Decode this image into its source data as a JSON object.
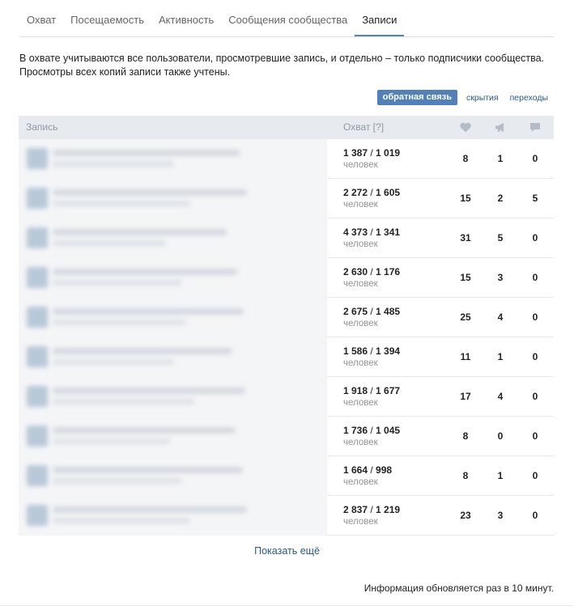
{
  "tabs": [
    {
      "label": "Охват"
    },
    {
      "label": "Посещаемость"
    },
    {
      "label": "Активность"
    },
    {
      "label": "Сообщения сообщества"
    },
    {
      "label": "Записи",
      "active": true
    }
  ],
  "description": {
    "line1": "В охвате учитываются все пользователи, просмотревшие запись, и отдельно – только подписчики сообщества.",
    "line2": "Просмотры всех копий записи также учтены."
  },
  "filters": {
    "feedback": "обратная связь",
    "hides": "скрытия",
    "clicks": "переходы"
  },
  "table": {
    "headers": {
      "post": "Запись",
      "reach": "Охват [?]",
      "likes_icon": "heart-icon",
      "shares_icon": "megaphone-icon",
      "comments_icon": "comment-icon"
    },
    "unit": "человек",
    "rows": [
      {
        "total": "1 387",
        "subscribers": "1 019",
        "likes": "8",
        "shares": "1",
        "comments": "0"
      },
      {
        "total": "2 272",
        "subscribers": "1 605",
        "likes": "15",
        "shares": "2",
        "comments": "5"
      },
      {
        "total": "4 373",
        "subscribers": "1 341",
        "likes": "31",
        "shares": "5",
        "comments": "0"
      },
      {
        "total": "2 630",
        "subscribers": "1 176",
        "likes": "15",
        "shares": "3",
        "comments": "0"
      },
      {
        "total": "2 675",
        "subscribers": "1 485",
        "likes": "25",
        "shares": "4",
        "comments": "0"
      },
      {
        "total": "1 586",
        "subscribers": "1 394",
        "likes": "11",
        "shares": "1",
        "comments": "0"
      },
      {
        "total": "1 918",
        "subscribers": "1 677",
        "likes": "17",
        "shares": "4",
        "comments": "0"
      },
      {
        "total": "1 736",
        "subscribers": "1 045",
        "likes": "8",
        "shares": "0",
        "comments": "0"
      },
      {
        "total": "1 664",
        "subscribers": "998",
        "likes": "8",
        "shares": "1",
        "comments": "0"
      },
      {
        "total": "2 837",
        "subscribers": "1 219",
        "likes": "23",
        "shares": "3",
        "comments": "0"
      }
    ]
  },
  "show_more": "Показать ещё",
  "footer_note": "Информация обновляется раз в 10 минут.",
  "colors": {
    "accent": "#5181b8",
    "link": "#2a5885",
    "header_bg": "#e7eaef"
  }
}
